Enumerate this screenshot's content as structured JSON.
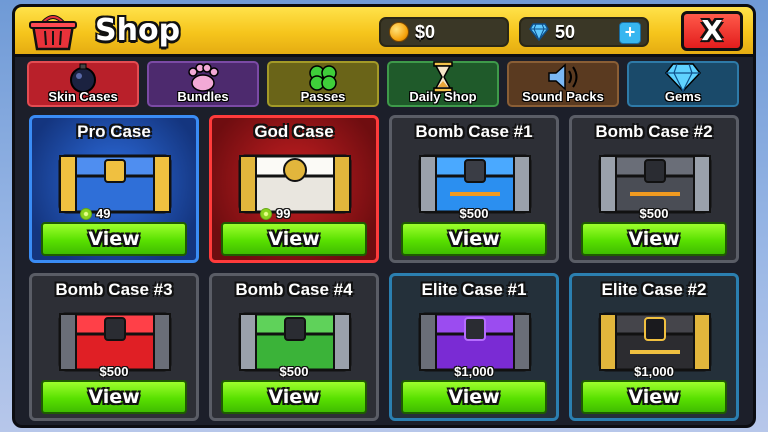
{
  "header": {
    "title": "Shop",
    "coins": "$0",
    "gems": "50",
    "plus_label": "+",
    "close_label": "X"
  },
  "tabs": [
    {
      "label": "Skin Cases",
      "icon": "bomb-icon",
      "active": true
    },
    {
      "label": "Bundles",
      "icon": "paw-icon"
    },
    {
      "label": "Passes",
      "icon": "clover-icon"
    },
    {
      "label": "Daily Shop",
      "icon": "hourglass-icon"
    },
    {
      "label": "Sound Packs",
      "icon": "speaker-icon"
    },
    {
      "label": "Gems",
      "icon": "gem-icon"
    }
  ],
  "cases": [
    {
      "name": "Pro Case",
      "price": "49",
      "currency": "rep",
      "color": "#2f6fd8",
      "button": "View"
    },
    {
      "name": "God Case",
      "price": "99",
      "currency": "rep",
      "color": "#e9e6df",
      "button": "View"
    },
    {
      "name": "Bomb Case #1",
      "price": "$500",
      "currency": "cash",
      "color": "#2b8ff0",
      "button": "View"
    },
    {
      "name": "Bomb Case #2",
      "price": "$500",
      "currency": "cash",
      "color": "#4a4d55",
      "button": "View"
    },
    {
      "name": "Bomb Case #3",
      "price": "$500",
      "currency": "cash",
      "color": "#e01f25",
      "button": "View"
    },
    {
      "name": "Bomb Case #4",
      "price": "$500",
      "currency": "cash",
      "color": "#3bb339",
      "button": "View"
    },
    {
      "name": "Elite Case #1",
      "price": "$1,000",
      "currency": "cash",
      "color": "#7a2bd4",
      "button": "View"
    },
    {
      "name": "Elite Case #2",
      "price": "$1,000",
      "currency": "cash",
      "color": "#2c2c30",
      "button": "View"
    }
  ]
}
